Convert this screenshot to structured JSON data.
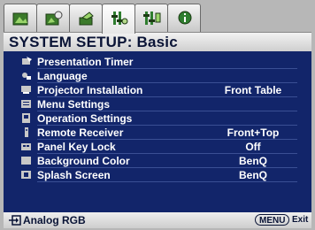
{
  "tabs": [
    {
      "name": "picture-tab",
      "icon": "picture-icon"
    },
    {
      "name": "advanced-picture-tab",
      "icon": "advanced-picture-icon"
    },
    {
      "name": "display-tab",
      "icon": "display-icon"
    },
    {
      "name": "system-setup-basic-tab",
      "icon": "system-setup-icon",
      "active": true
    },
    {
      "name": "system-setup-advanced-tab",
      "icon": "system-advanced-icon"
    },
    {
      "name": "information-tab",
      "icon": "information-icon"
    }
  ],
  "title": "SYSTEM SETUP: Basic",
  "items": [
    {
      "label": "Presentation Timer",
      "value": "",
      "icon": "timer-icon"
    },
    {
      "label": "Language",
      "value": "",
      "icon": "language-icon"
    },
    {
      "label": "Projector Installation",
      "value": "Front Table",
      "icon": "projector-icon"
    },
    {
      "label": "Menu Settings",
      "value": "",
      "icon": "menu-icon"
    },
    {
      "label": "Operation Settings",
      "value": "",
      "icon": "operation-icon"
    },
    {
      "label": "Remote Receiver",
      "value": "Front+Top",
      "icon": "remote-icon"
    },
    {
      "label": "Panel Key Lock",
      "value": "Off",
      "icon": "lock-icon"
    },
    {
      "label": "Background Color",
      "value": "BenQ",
      "icon": "background-icon"
    },
    {
      "label": "Splash Screen",
      "value": "BenQ",
      "icon": "splash-icon"
    }
  ],
  "status": {
    "source": "Analog RGB",
    "menu_key": "MENU",
    "exit": "Exit"
  },
  "colors": {
    "panel": "#12256a",
    "text": "#ffffff",
    "title_text": "#0a1436"
  }
}
